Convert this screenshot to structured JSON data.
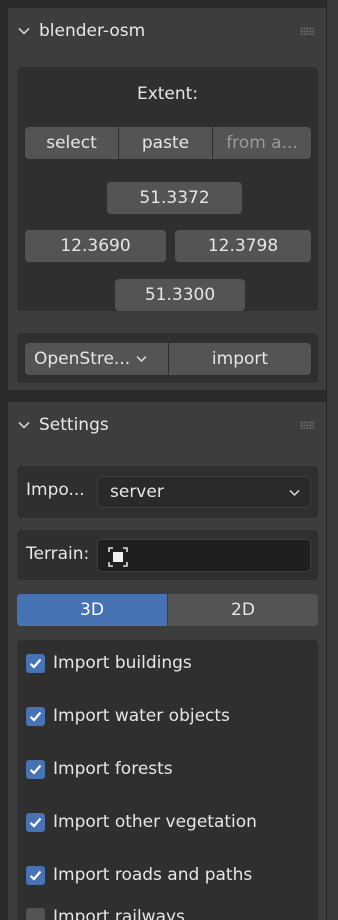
{
  "panels": {
    "blender_osm": {
      "title": "blender-osm",
      "extent_label": "Extent:",
      "buttons": {
        "select": "select",
        "paste": "paste",
        "from": "from a..."
      },
      "coords": {
        "north": "51.3372",
        "west": "12.3690",
        "east": "12.3798",
        "south": "51.3300"
      },
      "source_dropdown": "OpenStre...",
      "import_button": "import"
    },
    "settings": {
      "title": "Settings",
      "import_from_label": "Impo...",
      "import_from_value": "server",
      "terrain_label": "Terrain:",
      "mode_tabs": [
        {
          "label": "3D",
          "active": true
        },
        {
          "label": "2D",
          "active": false
        }
      ],
      "checkboxes": [
        {
          "label": "Import buildings",
          "checked": true
        },
        {
          "label": "Import water objects",
          "checked": true
        },
        {
          "label": "Import forests",
          "checked": true
        },
        {
          "label": "Import other vegetation",
          "checked": true
        },
        {
          "label": "Import roads and paths",
          "checked": true
        },
        {
          "label": "Import railways",
          "checked": false
        }
      ]
    }
  },
  "colors": {
    "accent": "#4772b3",
    "panel": "#3d3d3d",
    "box": "#2f2f2f",
    "button": "#545454",
    "editor_bg": "#2b2b2b"
  }
}
